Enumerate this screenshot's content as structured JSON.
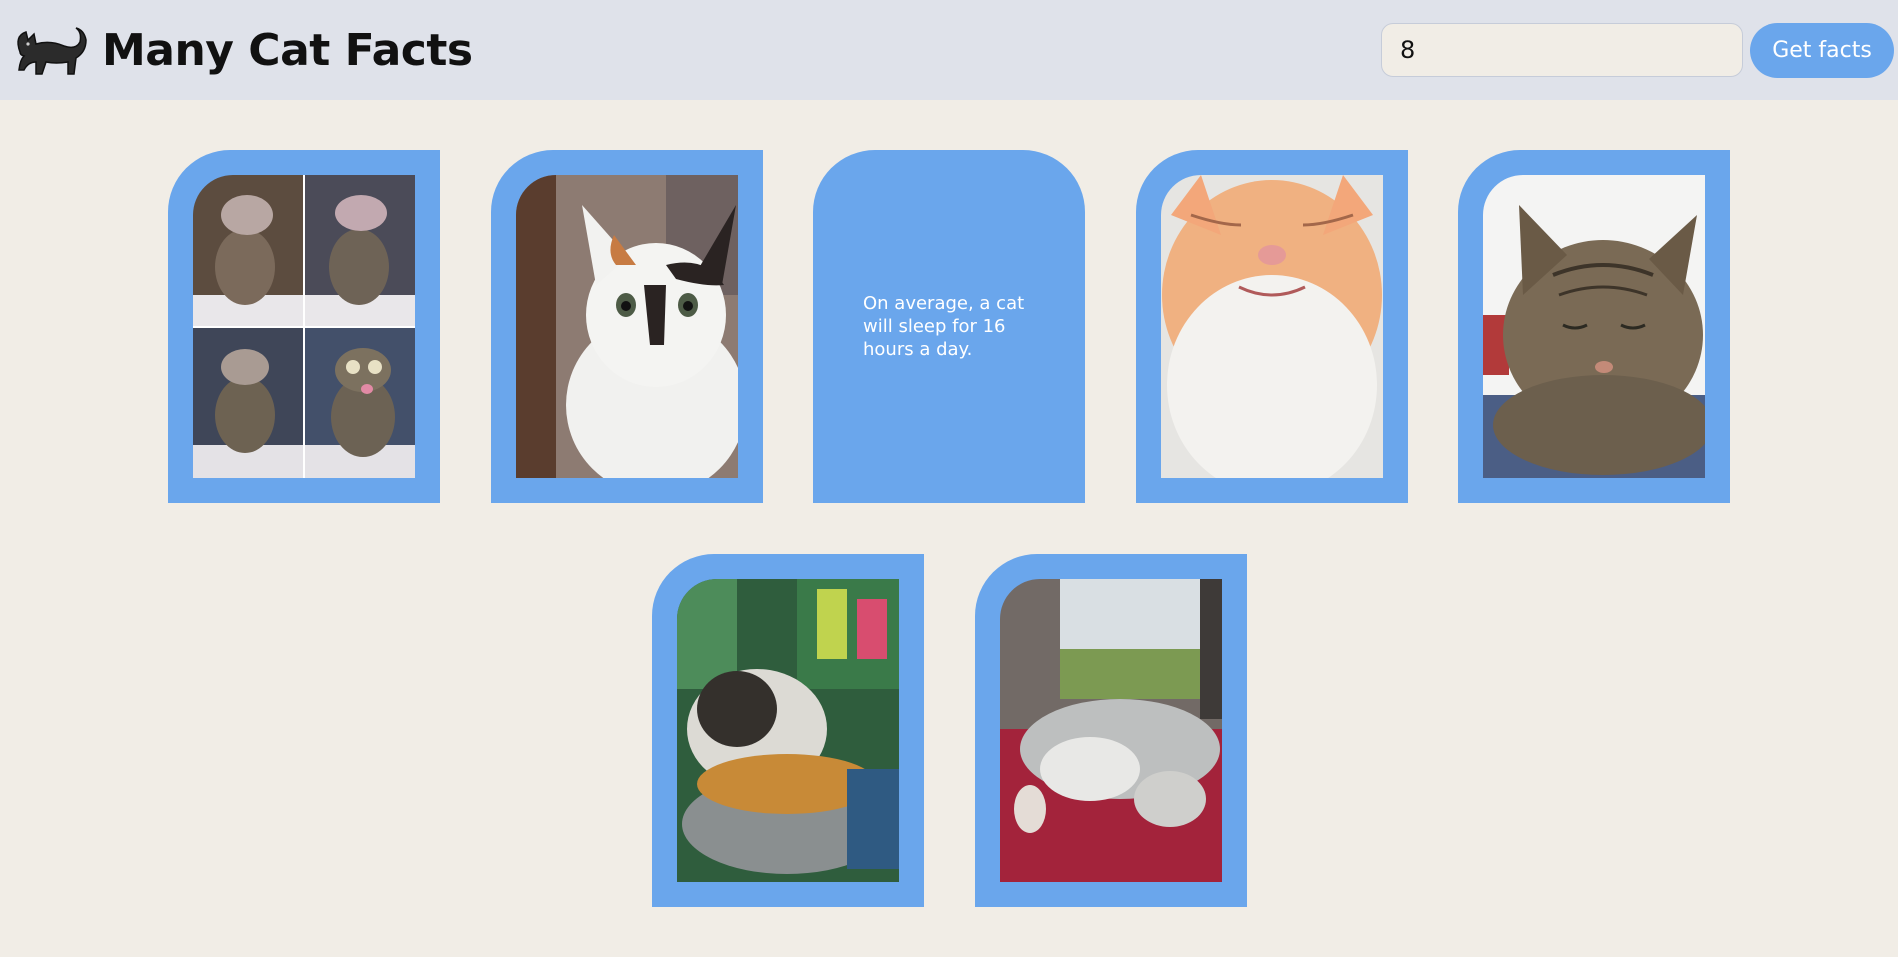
{
  "app": {
    "title": "Many Cat Facts",
    "logo_icon": "black-cat-icon"
  },
  "controls": {
    "count_value": "8",
    "submit_label": "Get facts"
  },
  "colors": {
    "header_bg": "#dfe2ea",
    "page_bg": "#f1ede6",
    "accent": "#6aa6ec"
  },
  "cards": [
    {
      "kind": "photo",
      "subject": "four-panel kitten collage"
    },
    {
      "kind": "photo",
      "subject": "white calico kitten"
    },
    {
      "kind": "fact",
      "text": "On average, a cat will sleep for 16 hours a day."
    },
    {
      "kind": "photo",
      "subject": "orange and white cat looking up"
    },
    {
      "kind": "photo",
      "subject": "tabby cat with eyes closed"
    },
    {
      "kind": "photo",
      "subject": "fluffy cat eating kibble"
    },
    {
      "kind": "photo",
      "subject": "grey and white cat sleeping by window"
    }
  ]
}
